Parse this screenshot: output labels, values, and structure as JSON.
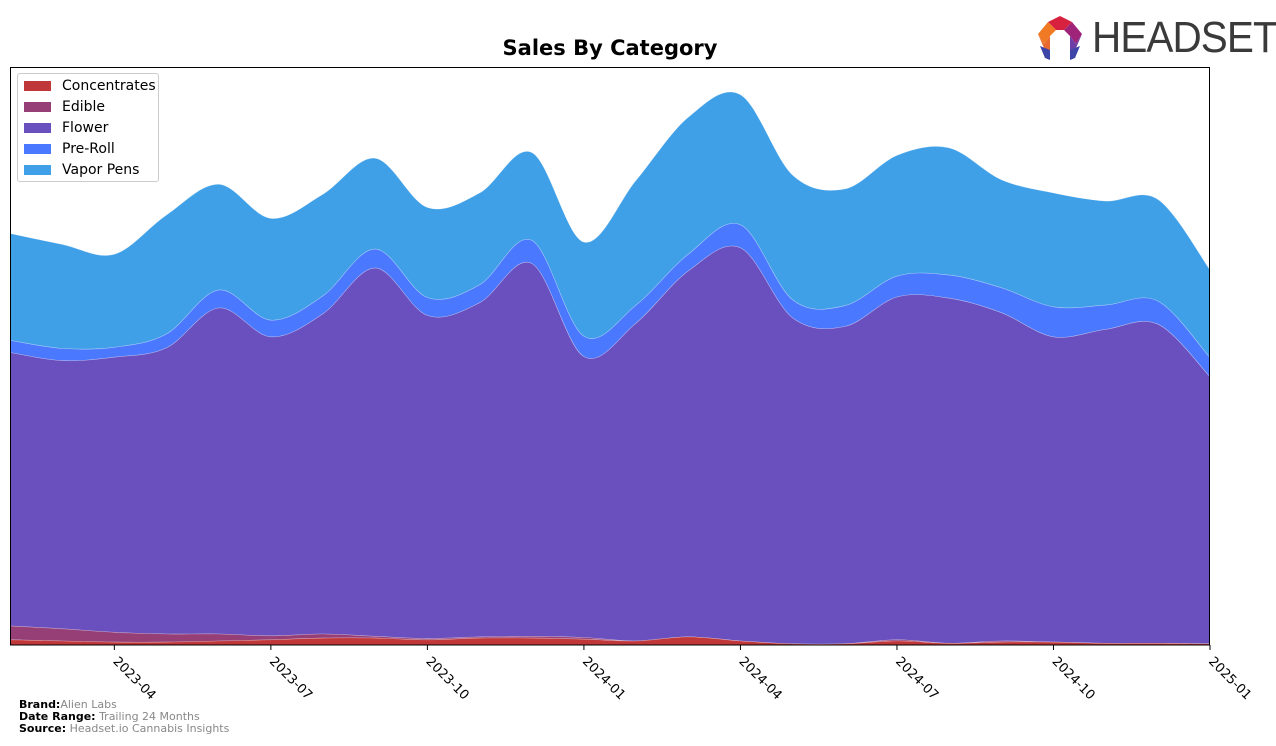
{
  "header": {
    "logo_text": "HEADSET",
    "logo_icon": "headset-logo-icon"
  },
  "chart_data": {
    "type": "area",
    "stacked": true,
    "smoothed": true,
    "title": "Sales By Category",
    "xlabel": "",
    "ylabel": "",
    "y_units": "relative (no y-axis labels shown)",
    "ylim": [
      0,
      100
    ],
    "grid": false,
    "legend_position": "top-left",
    "x": [
      "2023-02",
      "2023-03",
      "2023-04",
      "2023-05",
      "2023-06",
      "2023-07",
      "2023-08",
      "2023-09",
      "2023-10",
      "2023-11",
      "2023-12",
      "2024-01",
      "2024-02",
      "2024-03",
      "2024-04",
      "2024-05",
      "2024-06",
      "2024-07",
      "2024-08",
      "2024-09",
      "2024-10",
      "2024-11",
      "2024-12",
      "2025-01"
    ],
    "x_ticks": [
      "2023-04",
      "2023-07",
      "2023-10",
      "2024-01",
      "2024-04",
      "2024-07",
      "2024-10",
      "2025-01"
    ],
    "series": [
      {
        "name": "Concentrates",
        "color": "#c0373a",
        "values": [
          0.9,
          0.7,
          0.5,
          0.5,
          0.7,
          0.9,
          1.2,
          1.2,
          0.9,
          1.2,
          1.2,
          1.0,
          0.7,
          1.4,
          0.7,
          0.2,
          0.2,
          0.7,
          0.3,
          0.5,
          0.5,
          0.3,
          0.3,
          0.2
        ]
      },
      {
        "name": "Edible",
        "color": "#963f77",
        "values": [
          2.4,
          2.1,
          1.7,
          1.4,
          1.2,
          0.7,
          0.7,
          0.3,
          0.2,
          0.2,
          0.3,
          0.3,
          0.0,
          0.0,
          0.0,
          0.0,
          0.0,
          0.2,
          0.0,
          0.2,
          0.0,
          0.0,
          0.0,
          0.0
        ]
      },
      {
        "name": "Flower",
        "color": "#6a4fbe",
        "values": [
          47.3,
          46.4,
          47.6,
          49.5,
          56.4,
          51.7,
          55.4,
          63.7,
          55.9,
          57.8,
          64.5,
          48.6,
          55.0,
          63.3,
          68.0,
          56.4,
          54.9,
          59.3,
          59.7,
          56.8,
          52.8,
          54.3,
          55.2,
          46.2
        ]
      },
      {
        "name": "Pre-Roll",
        "color": "#4a78fe",
        "values": [
          2.1,
          2.1,
          1.7,
          2.4,
          3.1,
          2.9,
          3.1,
          3.3,
          3.1,
          3.1,
          4.0,
          3.5,
          3.1,
          2.9,
          4.0,
          3.1,
          3.6,
          3.6,
          4.0,
          4.3,
          5.2,
          4.2,
          4.0,
          3.3
        ]
      },
      {
        "name": "Vapor Pens",
        "color": "#3fa0e8",
        "values": [
          18.5,
          18.0,
          16.1,
          20.6,
          18.3,
          17.6,
          17.6,
          15.7,
          15.6,
          15.9,
          15.2,
          16.3,
          21.6,
          23.7,
          22.5,
          21.6,
          20.2,
          20.9,
          22.0,
          18.7,
          19.7,
          18.0,
          17.6,
          15.2
        ]
      }
    ]
  },
  "footer": {
    "brand_label": "Brand:",
    "brand_value": "Alien Labs",
    "date_range_label": "Date Range:",
    "date_range_value": "Trailing 24 Months",
    "source_label": "Source:",
    "source_value": "Headset.io Cannabis Insights"
  }
}
